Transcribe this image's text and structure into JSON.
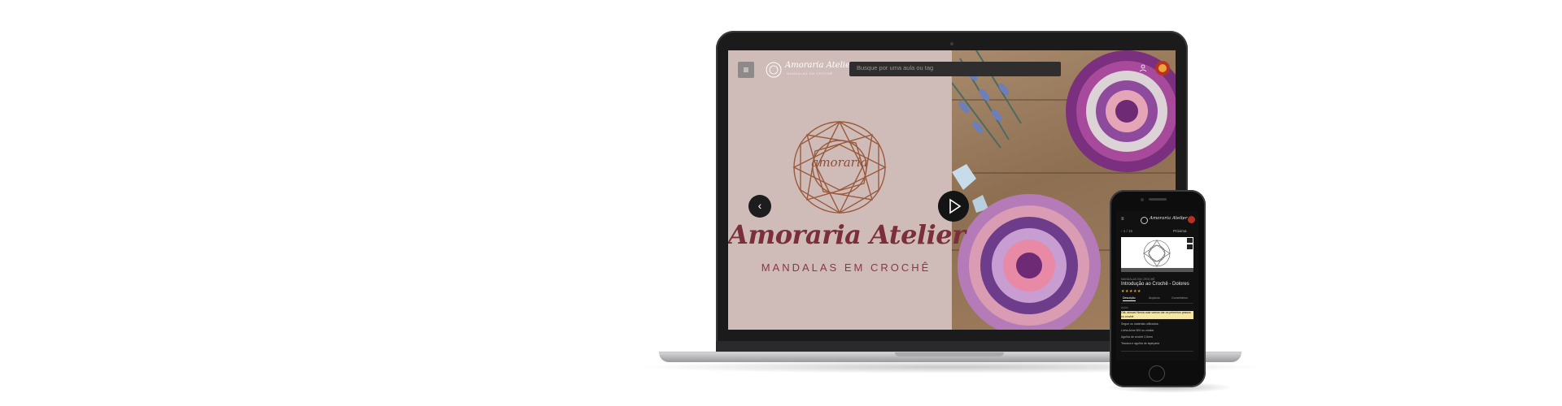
{
  "laptop": {
    "menu_icon": "menu-icon",
    "brand_name": "Amoraria Atelier",
    "brand_sub": "MANDALAS EM CROCHÊ",
    "search": {
      "placeholder": "Busque por uma aula ou tag"
    },
    "hero": {
      "logo_text": "amoraria",
      "title": "Amoraria Atelier",
      "subtitle": "MANDALAS EM CROCHÊ"
    },
    "prev_icon": "chevron-left-icon",
    "play_icon": "play-icon",
    "user_icon": "user-icon"
  },
  "phone": {
    "brand_name": "Amoraria Atelier",
    "row_left": "‹  1 / 15",
    "row_right": "Próxima",
    "category": "MANDALAS EM CROCHÊ",
    "title": "Introdução ao Crochê - Dolores",
    "rating_stars": "★★★★★",
    "tabs": [
      "Descrição",
      "Arquivos",
      "Comentários"
    ],
    "small_label": "Aulas",
    "highlight_text": "Olá, alunas! Nesta aula vamos dar os primeiros passos no crochê.",
    "lines": [
      "Segue os materiais utilizados:",
      "Linha Anne 500 ou similar",
      "Agulha de crochê 2,5mm",
      "Tesoura e agulha de tapeçaria"
    ]
  },
  "colors": {
    "hero_title": "#7b2f3b",
    "mandala": "#9a5a3d",
    "star": "#e1a723",
    "highlight": "#f4e7a6"
  }
}
